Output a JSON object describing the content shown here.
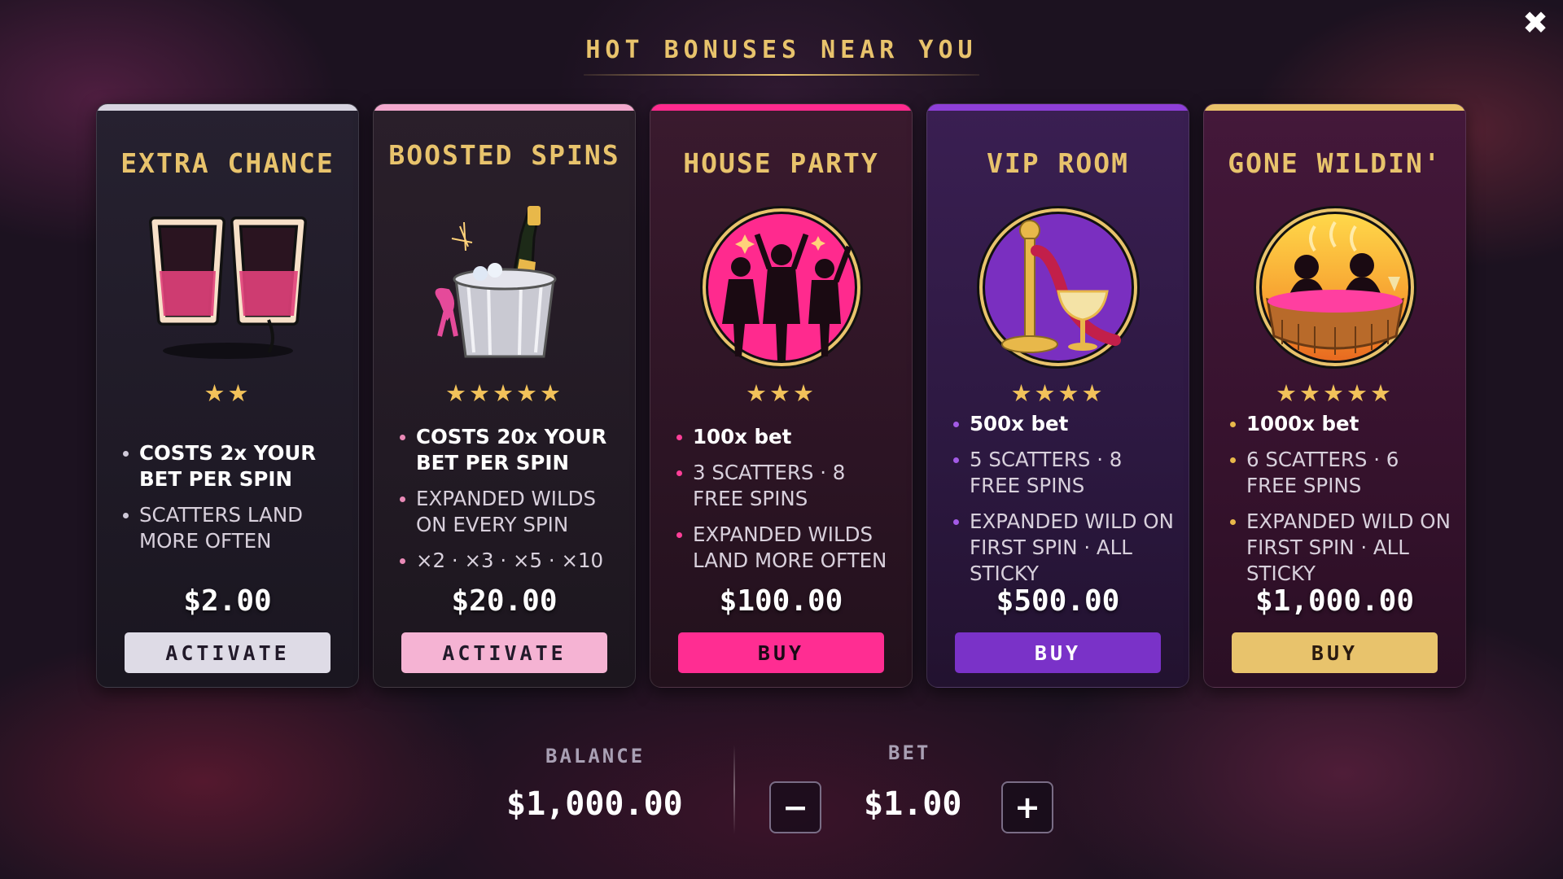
{
  "header": {
    "title": "HOT BONUSES NEAR YOU",
    "close_icon": "close-icon"
  },
  "cards": [
    {
      "name": "EXTRA CHANCE",
      "icon": "neon-shot-glasses-icon",
      "stars": "★★",
      "rating": 2,
      "features": [
        "COSTS 2x YOUR BET PER SPIN",
        "SCATTERS LAND MORE OFTEN"
      ],
      "price": "$2.00",
      "action": "ACTIVATE",
      "accent": "#d7d4e0",
      "button_color": "#dedbe6",
      "button_text_color": "#221a2a"
    },
    {
      "name": "BOOSTED SPINS",
      "icon": "champagne-bucket-icon",
      "stars": "★★★★★",
      "rating": 5,
      "features": [
        "COSTS 20x YOUR BET PER SPIN",
        "EXPANDED WILDS ON EVERY SPIN",
        "×2 · ×3 · ×5 · ×10"
      ],
      "price": "$20.00",
      "action": "ACTIVATE",
      "accent": "#f2a8cd",
      "button_color": "#f5b3d3",
      "button_text_color": "#221a2a"
    },
    {
      "name": "HOUSE PARTY",
      "icon": "dancing-party-icon",
      "stars": "★★★",
      "rating": 3,
      "features": [
        "100x bet",
        "3 SCATTERS · 8 FREE SPINS",
        "EXPANDED WILDS LAND MORE OFTEN"
      ],
      "price": "$100.00",
      "action": "BUY",
      "accent": "#ff2a8e",
      "button_color": "#ff2d92",
      "button_text_color": "#1a0a16"
    },
    {
      "name": "VIP ROOM",
      "icon": "vip-rope-cocktail-icon",
      "stars": "★★★★",
      "rating": 4,
      "features": [
        "500x bet",
        "5 SCATTERS · 8 FREE SPINS",
        "EXPANDED WILD ON FIRST SPIN · ALL STICKY"
      ],
      "price": "$500.00",
      "action": "BUY",
      "accent": "#8e3fd8",
      "button_color": "#7a32c8",
      "button_text_color": "#ffffff"
    },
    {
      "name": "GONE WILDIN'",
      "icon": "hot-tub-icon",
      "stars": "★★★★★",
      "rating": 5,
      "features": [
        "1000x bet",
        "6 SCATTERS · 6 FREE SPINS",
        "EXPANDED WILD ON FIRST SPIN · ALL STICKY"
      ],
      "price": "$1,000.00",
      "action": "BUY",
      "accent": "#e9c26a",
      "button_color": "#e8c36c",
      "button_text_color": "#2a1a10"
    }
  ],
  "footer": {
    "balance_label": "BALANCE",
    "balance_value": "$1,000.00",
    "bet_label": "BET",
    "bet_value": "$1.00",
    "minus_label": "−",
    "plus_label": "+"
  }
}
